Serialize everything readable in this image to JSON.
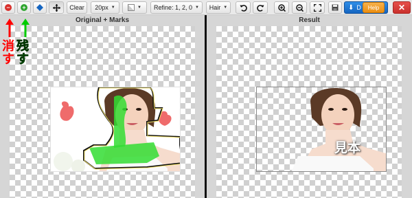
{
  "toolbar": {
    "clear_label": "Clear",
    "brush_size": "20px",
    "refine_label": "Refine: 1, 2, 0",
    "hair_label": "Hair",
    "download_label": "D",
    "help_label": "Help",
    "close_label": "✕"
  },
  "panels": {
    "left_title": "Original + Marks",
    "right_title": "Result"
  },
  "annotations": {
    "remove_text": "消す",
    "keep_text": "残す",
    "remove_color": "#ff0000",
    "keep_color": "#00cc00"
  },
  "watermark": "見本",
  "colors": {
    "remove_mark": "#ef6b6b",
    "keep_mark": "#33dd33",
    "help_bg": "#f0a030",
    "download_bg": "#1e78d8",
    "close_bg": "#d9433e"
  }
}
